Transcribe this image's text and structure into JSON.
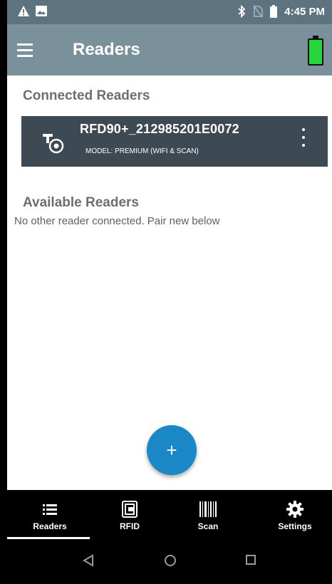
{
  "status_bar": {
    "time": "4:45 PM",
    "icons": [
      "warning-icon",
      "image-icon",
      "bluetooth-icon",
      "no-sim-icon",
      "battery-icon"
    ]
  },
  "app_bar": {
    "title": "Readers",
    "menu_icon": "hamburger-menu-icon",
    "battery_icon": "battery-full-icon",
    "battery_color": "#27d63a"
  },
  "connected": {
    "heading": "Connected Readers",
    "reader": {
      "name": "RFD90+_212985201E0072",
      "model": "MODEL: PREMIUM (WIFI & SCAN)",
      "icon": "rfid-reader-icon",
      "menu_icon": "more-vert-icon"
    }
  },
  "available": {
    "heading": "Available Readers",
    "message": "No other reader connected. Pair new below"
  },
  "fab": {
    "label": "+",
    "accent": "#1a87c7"
  },
  "bottom_nav": {
    "active": "Readers",
    "items": [
      {
        "label": "Readers",
        "icon": "list-icon"
      },
      {
        "label": "RFID",
        "icon": "rfid-icon"
      },
      {
        "label": "Scan",
        "icon": "barcode-icon"
      },
      {
        "label": "Settings",
        "icon": "gear-icon"
      }
    ]
  },
  "system_nav": {
    "icons": [
      "back-icon",
      "home-icon",
      "recents-icon"
    ]
  }
}
